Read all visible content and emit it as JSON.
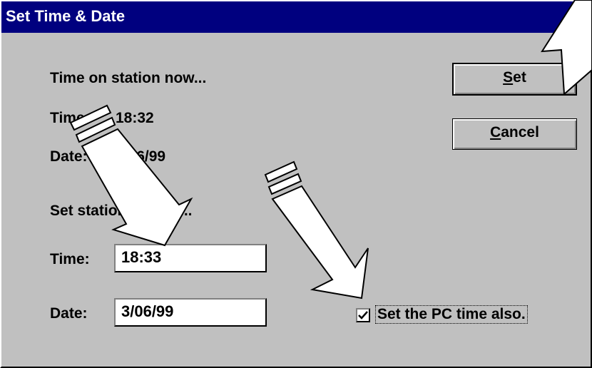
{
  "window": {
    "title": "Set Time & Date"
  },
  "current": {
    "heading": "Time on station now...",
    "time_label": "Time:",
    "time_value": "18:32",
    "date_label": "Date:",
    "date_value": "3/06/99"
  },
  "set": {
    "heading": "Set station time to...",
    "time_label": "Time:",
    "time_value": "18:33",
    "date_label": "Date:",
    "date_value": "3/06/99"
  },
  "buttons": {
    "set_mnemonic": "S",
    "set_rest": "et",
    "cancel_mnemonic": "C",
    "cancel_rest": "ancel"
  },
  "checkbox": {
    "label": "Set the PC time also.",
    "checked": true
  },
  "annotations": {
    "arrow_fill": "#ffffff",
    "arrow_stroke": "#000000"
  }
}
